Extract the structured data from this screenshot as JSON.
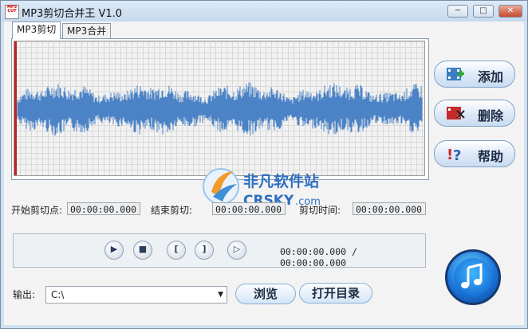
{
  "window": {
    "title": "MP3剪切合并王 V1.0",
    "icon_text": "MP3\nCUT",
    "controls": [
      "minimize-icon",
      "maximize-icon",
      "close-icon"
    ]
  },
  "tabs": [
    {
      "label": "MP3剪切",
      "active": true
    },
    {
      "label": "MP3合并",
      "active": false
    }
  ],
  "side_buttons": {
    "add": "添加",
    "delete": "删除",
    "help": "帮助"
  },
  "cut": {
    "start_label": "开始剪切点:",
    "start_value": "00:00:00.000",
    "end_label": "结束剪切:",
    "end_value": "00:00:00.000",
    "duration_label": "剪切时间:",
    "duration_value": "00:00:00.000"
  },
  "playback": {
    "buttons": [
      "play-icon",
      "stop-icon",
      "mark-start-icon",
      "mark-end-icon",
      "play-selection-icon"
    ],
    "time": "00:00:00.000 / 00:00:00.000"
  },
  "output": {
    "label": "输出:",
    "path": "C:\\",
    "browse": "浏览",
    "open_dir": "打开目录"
  },
  "watermark": {
    "brand": "非凡软件站",
    "domain": "CRSKY",
    "tld": ".com"
  },
  "colors": {
    "wave": "#4b83c6",
    "cursor": "#c02020",
    "accent": "#1a74d8"
  }
}
